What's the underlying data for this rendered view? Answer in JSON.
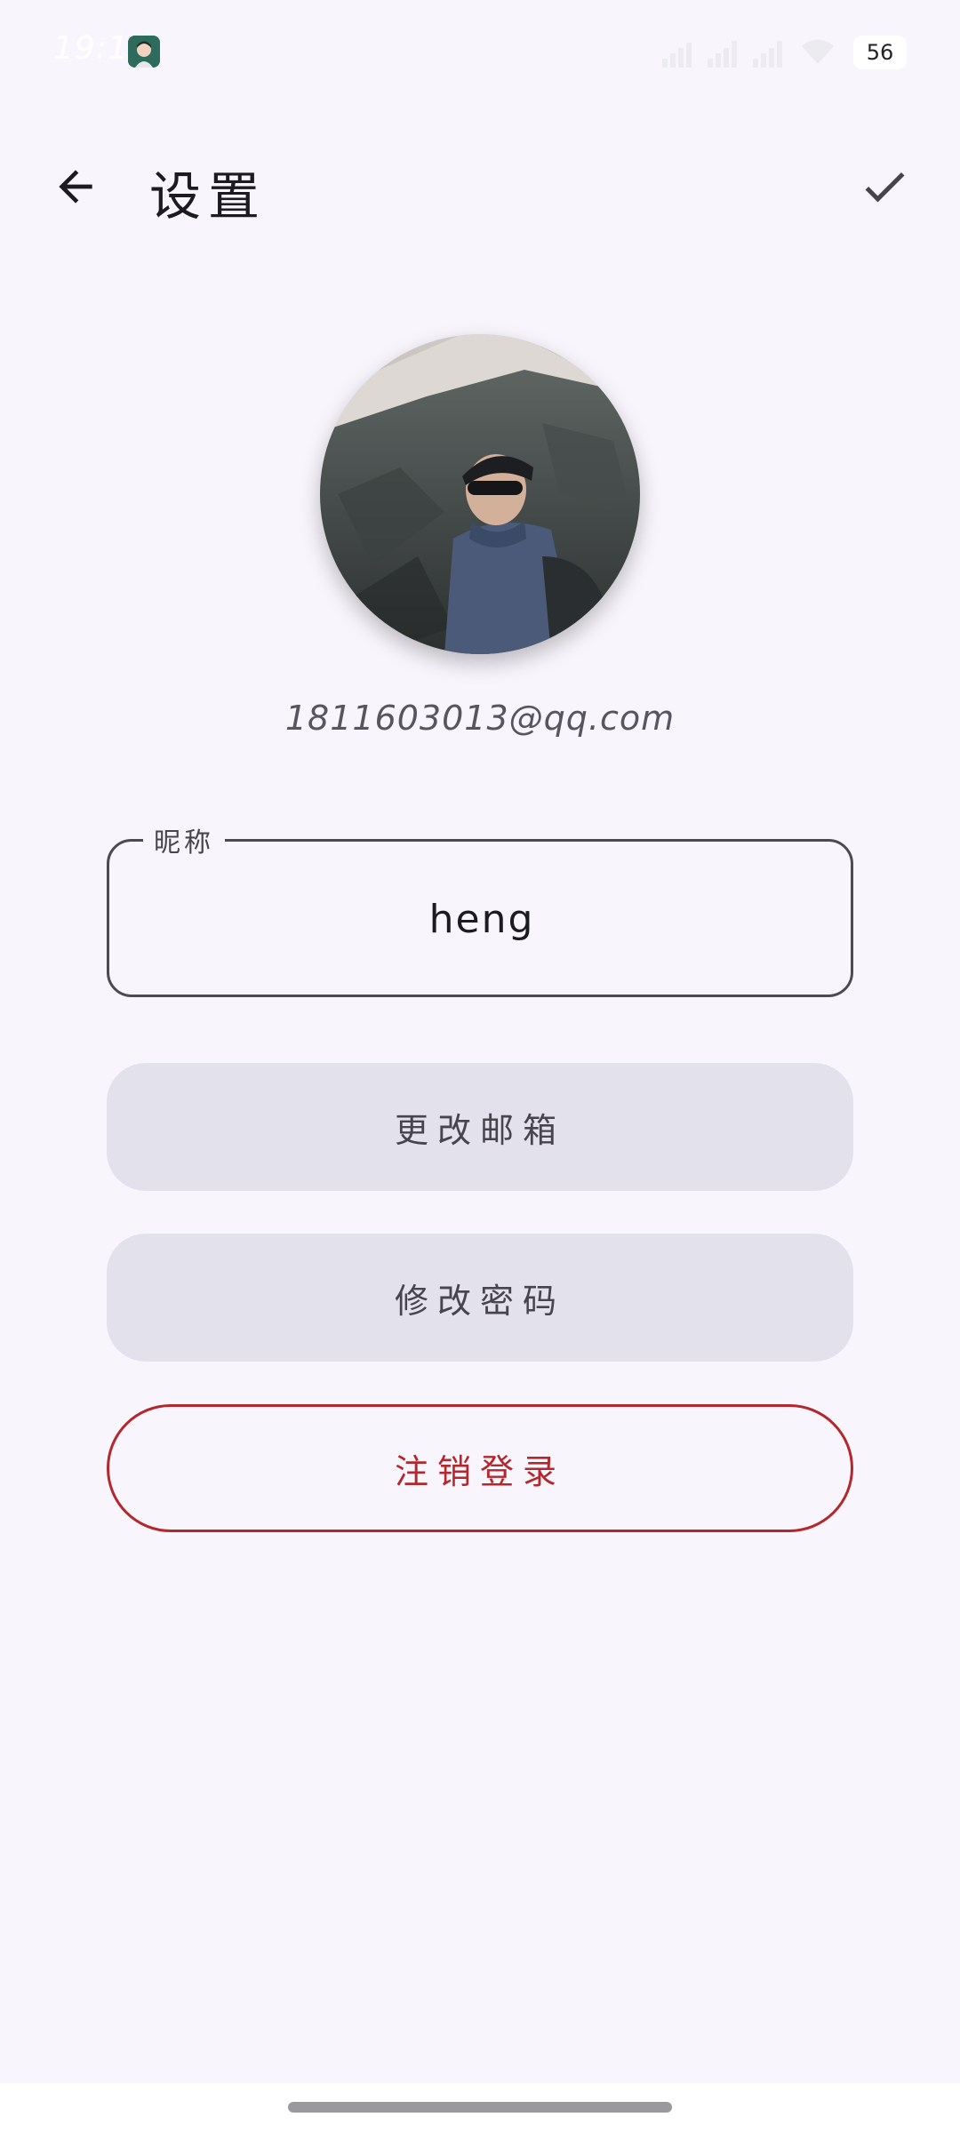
{
  "status_bar": {
    "time": "19:16",
    "app_icon": "avatar-app-icon",
    "battery": "56",
    "icons": [
      "hd-signal-icon",
      "signal-icon",
      "signal-icon",
      "wifi-icon",
      "battery-icon"
    ]
  },
  "app_bar": {
    "title": "设置",
    "back_icon": "arrow-back-icon",
    "confirm_icon": "check-icon"
  },
  "profile": {
    "avatar": "profile-photo",
    "email": "1811603013@qq.com"
  },
  "nickname": {
    "label": "昵称",
    "value": "heng"
  },
  "actions": {
    "change_email": "更改邮箱",
    "change_password": "修改密码",
    "logout": "注销登录"
  },
  "colors": {
    "background": "#f8f6fc",
    "tonal_button": "#e3e1ec",
    "logout_accent": "#b3282d",
    "outline": "#4d4a52"
  }
}
